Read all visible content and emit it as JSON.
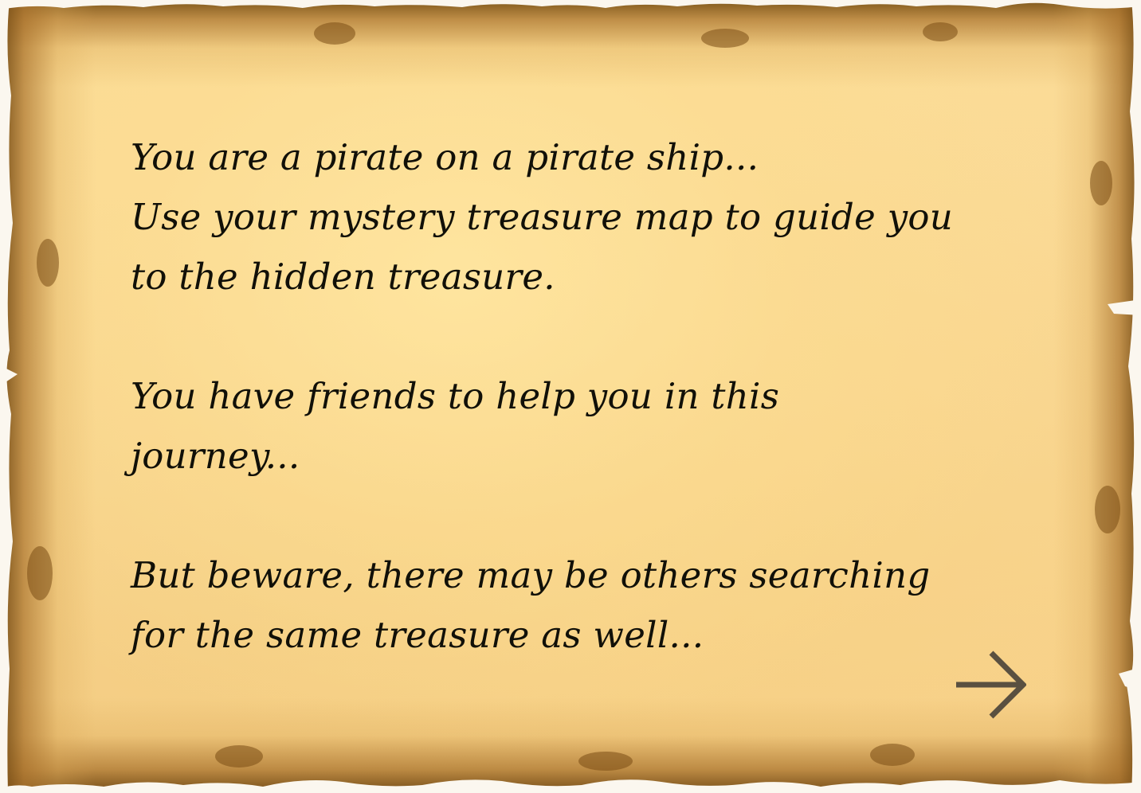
{
  "story": {
    "lines": [
      "You are a pirate on a pirate ship...",
      "Use your mystery treasure map to guide you",
      "to the hidden treasure.",
      "",
      "You have friends to help you in this",
      "journey...",
      "",
      "But beware, there may be others searching",
      "for the same treasure as well..."
    ]
  },
  "navigation": {
    "next_icon": "arrow-right-icon"
  },
  "colors": {
    "parchment": "#fad895",
    "burnt_edge": "#8a5a1c",
    "text": "#111008",
    "arrow": "#5a5040"
  }
}
